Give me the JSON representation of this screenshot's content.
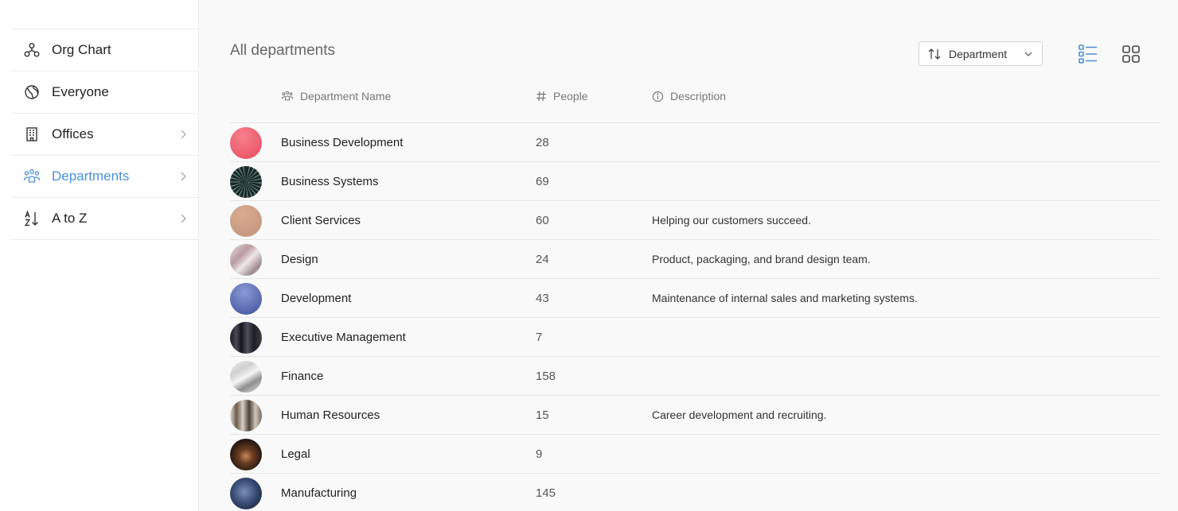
{
  "sidebar": {
    "items": [
      {
        "label": "Org Chart",
        "icon": "org-chart-icon"
      },
      {
        "label": "Everyone",
        "icon": "globe-icon"
      },
      {
        "label": "Offices",
        "icon": "building-icon"
      },
      {
        "label": "Departments",
        "icon": "people-group-icon",
        "active": true
      },
      {
        "label": "A to Z",
        "icon": "sort-alpha-icon"
      }
    ],
    "accent_color": "#4a90d9"
  },
  "main": {
    "title": "All departments",
    "sort": {
      "label": "Department"
    },
    "columns": {
      "name": "Department Name",
      "people": "People",
      "description": "Description"
    },
    "rows": [
      {
        "name": "Business Development",
        "people": "28",
        "description": ""
      },
      {
        "name": "Business Systems",
        "people": "69",
        "description": ""
      },
      {
        "name": "Client Services",
        "people": "60",
        "description": "Helping our customers succeed."
      },
      {
        "name": "Design",
        "people": "24",
        "description": "Product, packaging, and brand design team."
      },
      {
        "name": "Development",
        "people": "43",
        "description": "Maintenance of internal sales and marketing systems."
      },
      {
        "name": "Executive Management",
        "people": "7",
        "description": ""
      },
      {
        "name": "Finance",
        "people": "158",
        "description": ""
      },
      {
        "name": "Human Resources",
        "people": "15",
        "description": "Career development and recruiting."
      },
      {
        "name": "Legal",
        "people": "9",
        "description": ""
      },
      {
        "name": "Manufacturing",
        "people": "145",
        "description": ""
      }
    ]
  }
}
